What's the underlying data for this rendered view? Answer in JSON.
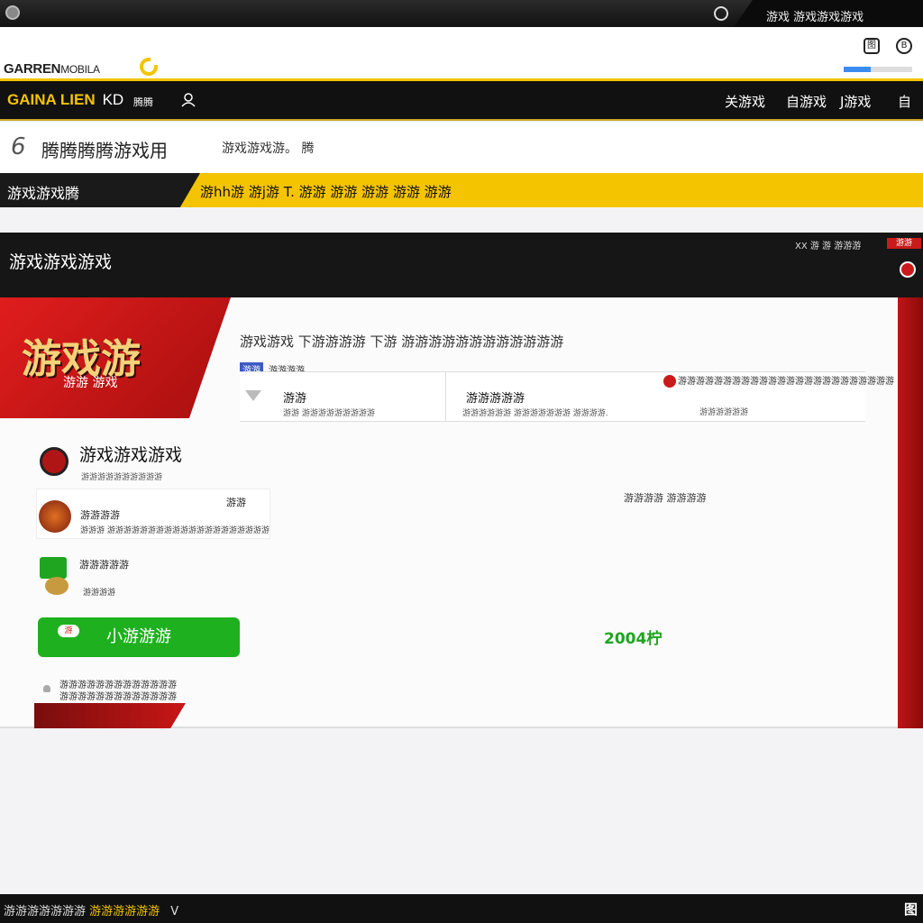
{
  "topbar": {
    "system_text": "游戏 游戏游戏游戏"
  },
  "brand": {
    "name": "GARRENMOBILA",
    "name_main": "GARREN",
    "name_suffix": "MOBILA",
    "toolbar_btn_1": "图",
    "toolbar_btn_2": "B",
    "load_progress": 0.4
  },
  "nav": {
    "brand": "GAINA LIEN",
    "brand_suffix": "KD",
    "extra_1": "腾腾",
    "links": [
      "关游戏",
      "自游戏",
      "J游戏",
      "自"
    ]
  },
  "header": {
    "number": "6",
    "title": "腾腾腾腾游戏用",
    "subtitle": "游戏游戏游。 腾"
  },
  "banner": {
    "left_label": "游戏游戏腾",
    "text": "游hh游 游j游 T. 游游 游游 游游 游游 游游"
  },
  "panel": {
    "title": "游戏游戏游戏",
    "top_links": "XX 游 游 游游游",
    "top_red": "游游"
  },
  "hero": {
    "big_text": "游戏游",
    "small_text": "游游 游戏"
  },
  "info": {
    "line": "游戏游戏 下游游游游 下游 游游游游游游游游游游游游",
    "tag_label": "游游",
    "tag_text": "游游游游"
  },
  "stats": [
    {
      "label": "游游",
      "note": "游游 游游游游游游游游游"
    },
    {
      "label": "游游游游游",
      "note": "游游游游游游 游游游游游游游 游游游游."
    },
    {
      "label": "",
      "note": "游游游游游游游游游游游游游游游游"
    }
  ],
  "right_note": {
    "text": "游游游游游游游游游游游游游游游游游游游游游游游游",
    "sub": "游游游游游游"
  },
  "side": {
    "title": "游戏游戏游戏",
    "subtitle": "游游游游游游游游游游"
  },
  "items": [
    {
      "title": "游游游游",
      "sub": "游游游 游游游游游游游游游游游游游游游游游游游游",
      "tag": "游游"
    },
    {
      "title": "游游游游游",
      "sub": "游游游游",
      "tag": ""
    }
  ],
  "mid_text": "游游游游 游游游游",
  "action": {
    "label": "小游游游",
    "badge": "游"
  },
  "green_number": "2004柠",
  "footer_note": {
    "line1": "游游游游游游游游游游游游游",
    "line2": "游游游游游游游游游游游游游"
  },
  "bottombar": {
    "text_plain": "游游游游游游游 ",
    "text_gold": "游游游游游游",
    "chevron": "V",
    "right": "图"
  },
  "colors": {
    "accent_yellow": "#f5c400",
    "accent_red": "#c91b1b",
    "accent_green": "#1fb01f",
    "dark": "#111111"
  }
}
